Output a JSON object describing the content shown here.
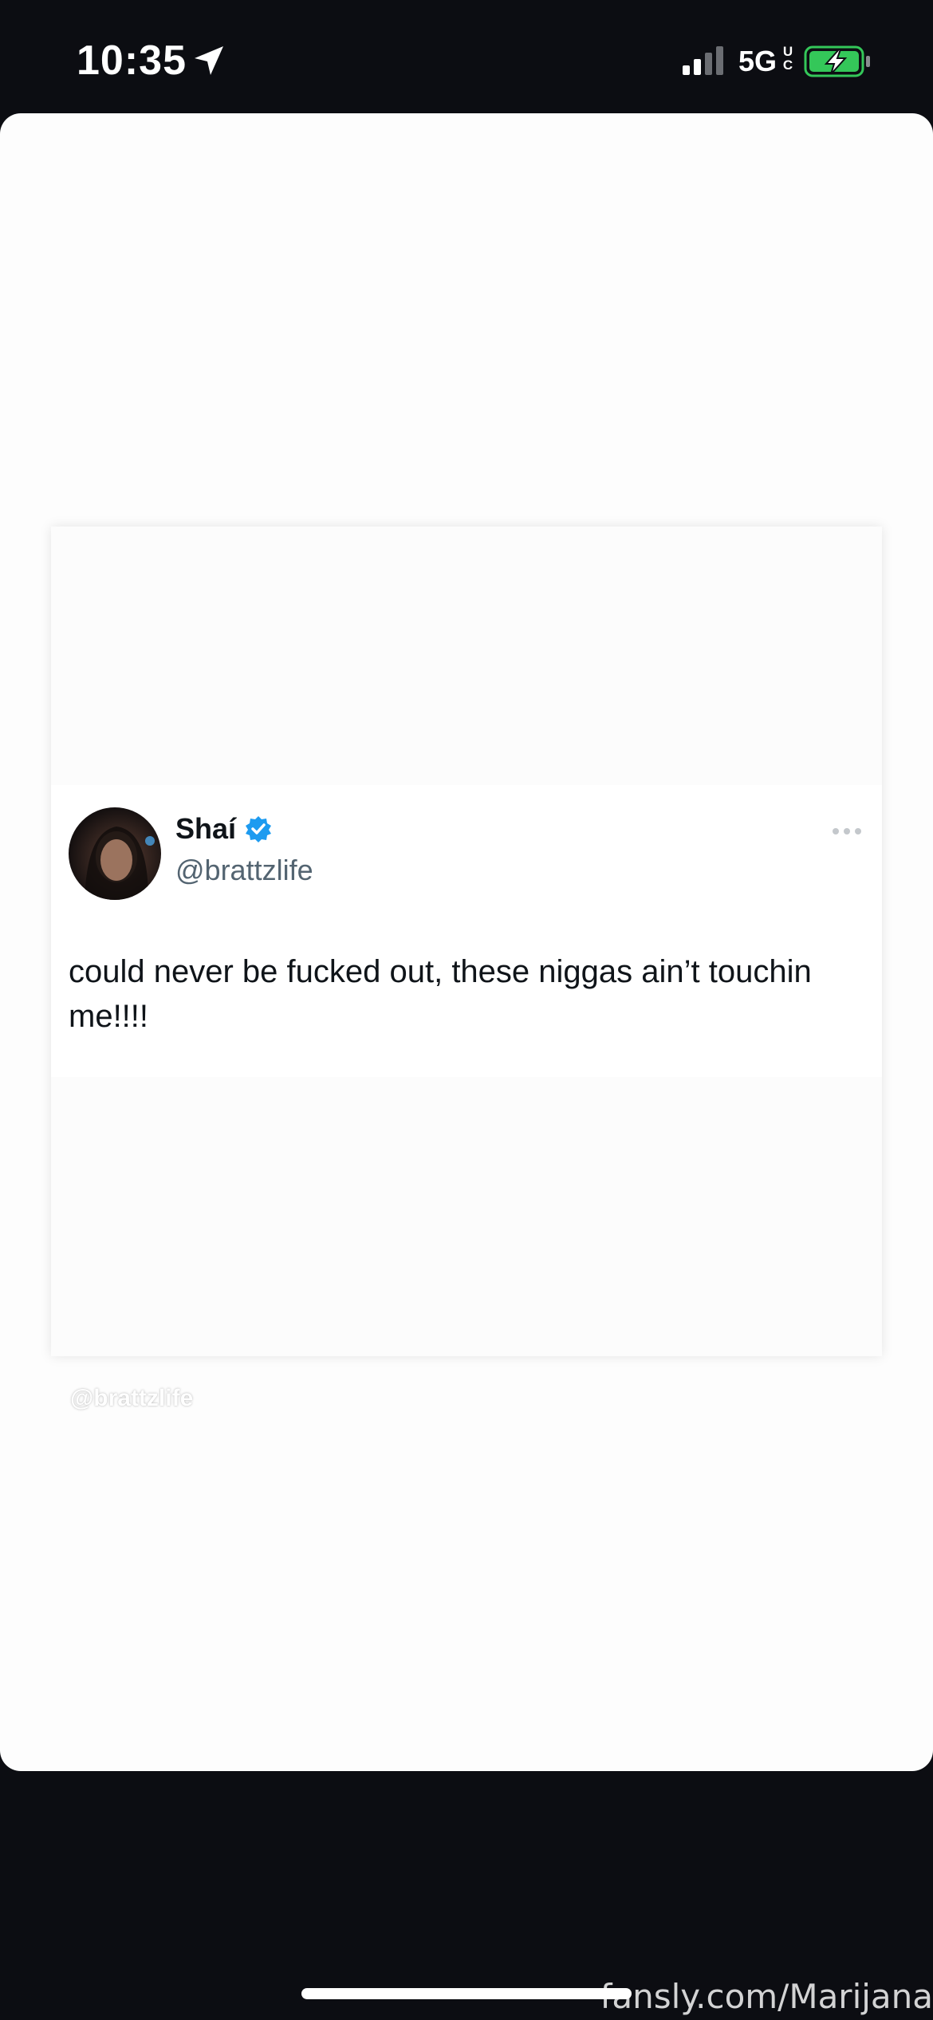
{
  "status_bar": {
    "time": "10:35",
    "network": "5G",
    "network_superscript_top": "U",
    "network_superscript_bottom": "C",
    "icons": [
      "location-arrow-icon",
      "signal-icon",
      "battery-charging-icon"
    ],
    "battery_color": "#34c759"
  },
  "tweet": {
    "display_name": "Shaí",
    "handle": "@brattzlife",
    "text": "could never be fucked out, these niggas ain’t touchin me!!!!",
    "verified_color": "#1d9bf0",
    "icons": [
      "verified-badge-icon",
      "more-options-icon"
    ]
  },
  "overlay": {
    "watermark_handle": "@brattzlife"
  },
  "footer": {
    "watermark": "fansly.com/Marijana"
  }
}
